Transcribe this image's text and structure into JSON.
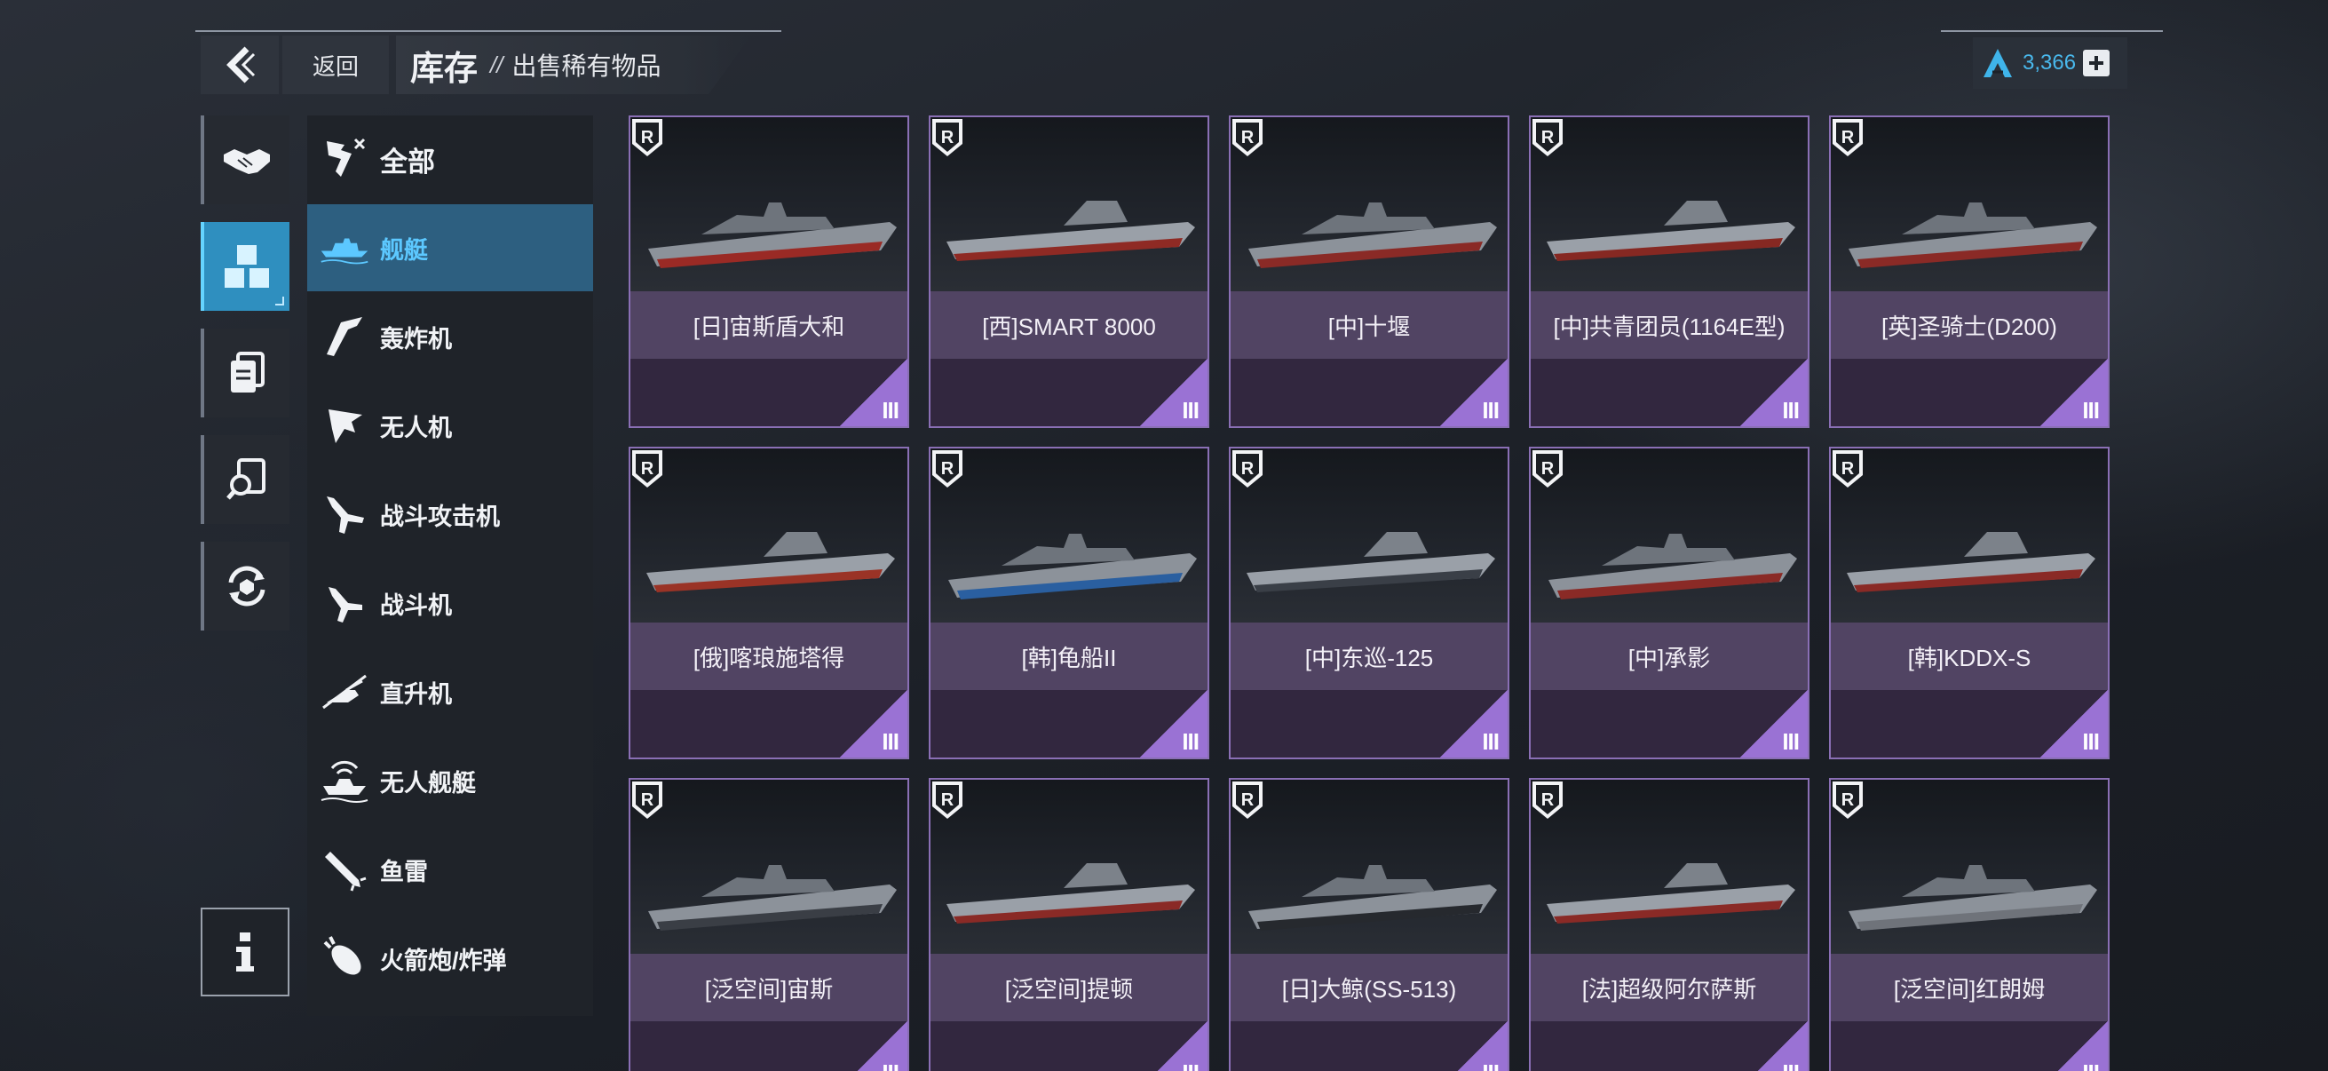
{
  "header": {
    "back_label": "返回",
    "title": "库存",
    "separator": "//",
    "subtitle": "出售稀有物品"
  },
  "currency": {
    "value": "3,366",
    "icon": "currency-a-icon"
  },
  "rail": [
    {
      "name": "handshake-icon",
      "active": false
    },
    {
      "name": "cubes-icon",
      "active": true
    },
    {
      "name": "cards-icon",
      "active": false
    },
    {
      "name": "search-doc-icon",
      "active": false
    },
    {
      "name": "recycle-icon",
      "active": false
    }
  ],
  "categories": [
    {
      "label": "全部",
      "icon": "all-icon",
      "active": false
    },
    {
      "label": "舰艇",
      "icon": "warship-icon",
      "active": true
    },
    {
      "label": "轰炸机",
      "icon": "bomber-icon",
      "active": false
    },
    {
      "label": "无人机",
      "icon": "drone-icon",
      "active": false
    },
    {
      "label": "战斗攻击机",
      "icon": "strike-fighter-icon",
      "active": false
    },
    {
      "label": "战斗机",
      "icon": "fighter-icon",
      "active": false
    },
    {
      "label": "直升机",
      "icon": "helicopter-icon",
      "active": false
    },
    {
      "label": "无人舰艇",
      "icon": "unmanned-ship-icon",
      "active": false
    },
    {
      "label": "鱼雷",
      "icon": "torpedo-icon",
      "active": false
    },
    {
      "label": "火箭炮/炸弹",
      "icon": "rocket-bomb-icon",
      "active": false
    }
  ],
  "items": [
    {
      "name": "[日]宙斯盾大和",
      "rank": "R",
      "tier": "III",
      "hull": "#9a2a25"
    },
    {
      "name": "[西]SMART 8000",
      "rank": "R",
      "tier": "III",
      "hull": "#8f2a24"
    },
    {
      "name": "[中]十堰",
      "rank": "R",
      "tier": "III",
      "hull": "#8a2a26"
    },
    {
      "name": "[中]共青团员(1164E型)",
      "rank": "R",
      "tier": "III",
      "hull": "#862822"
    },
    {
      "name": "[英]圣骑士(D200)",
      "rank": "R",
      "tier": "III",
      "hull": "#8a2a26"
    },
    {
      "name": "[俄]喀琅施塔得",
      "rank": "R",
      "tier": "III",
      "hull": "#9a3326"
    },
    {
      "name": "[韩]龟船II",
      "rank": "R",
      "tier": "III",
      "hull": "#2a5fa0"
    },
    {
      "name": "[中]东巡-125",
      "rank": "R",
      "tier": "III",
      "hull": "#3a3f47"
    },
    {
      "name": "[中]承影",
      "rank": "R",
      "tier": "III",
      "hull": "#8a2a26"
    },
    {
      "name": "[韩]KDDX-S",
      "rank": "R",
      "tier": "III",
      "hull": "#8a2a26"
    },
    {
      "name": "[泛空间]宙斯",
      "rank": "R",
      "tier": "III",
      "hull": "#3a3e45"
    },
    {
      "name": "[泛空间]提顿",
      "rank": "R",
      "tier": "III",
      "hull": "#8a2a26"
    },
    {
      "name": "[日]大鲸(SS-513)",
      "rank": "R",
      "tier": "III",
      "hull": "#26292e"
    },
    {
      "name": "[法]超级阿尔萨斯",
      "rank": "R",
      "tier": "III",
      "hull": "#8a2a26"
    },
    {
      "name": "[泛空间]红朗姆",
      "rank": "R",
      "tier": "III",
      "hull": "#6f737a"
    }
  ],
  "colors": {
    "accent": "#2f8fbf",
    "card_border": "#8a6fb5",
    "card_name_bg": "#514463",
    "card_foot_bg": "#32273f",
    "tier_corner": "#9a72d4",
    "currency_text": "#49b8ec"
  }
}
